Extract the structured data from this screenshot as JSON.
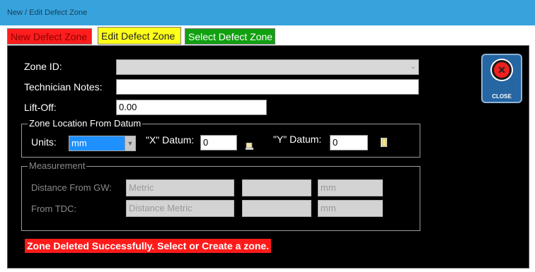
{
  "window": {
    "title": "New / Edit Defect Zone"
  },
  "tabs": {
    "new": "New Defect Zone",
    "edit": "Edit Defect Zone",
    "select": "Select Defect Zone"
  },
  "form": {
    "zone_id_label": "Zone ID:",
    "zone_id_value": "",
    "tech_notes_label": "Technician Notes:",
    "tech_notes_value": "",
    "liftoff_label": "Lift-Off:",
    "liftoff_value": "0.00"
  },
  "location": {
    "group_title": "Zone Location From Datum",
    "units_label": "Units:",
    "units_value": "mm",
    "x_label": "\"X\" Datum:",
    "x_value": "0",
    "y_label": "\"Y\" Datum:",
    "y_value": "0"
  },
  "measurement": {
    "group_title": "Measurement",
    "distance_gw_label": "Distance From GW:",
    "distance_gw_type": "Metric",
    "distance_gw_value": "",
    "distance_gw_unit": "mm",
    "from_tdc_label": "From TDC:",
    "from_tdc_type": "Distance Metric",
    "from_tdc_value": "",
    "from_tdc_unit": "mm"
  },
  "close_button": {
    "label": "CLOSE"
  },
  "status": {
    "message": "Zone Deleted Successfully. Select or Create a zone."
  },
  "colors": {
    "titlebar": "#36a3dd",
    "tab_new": "#ff1d1d",
    "tab_edit": "#ffff1a",
    "tab_select": "#10a010",
    "status_bg": "#ff1a1a"
  }
}
